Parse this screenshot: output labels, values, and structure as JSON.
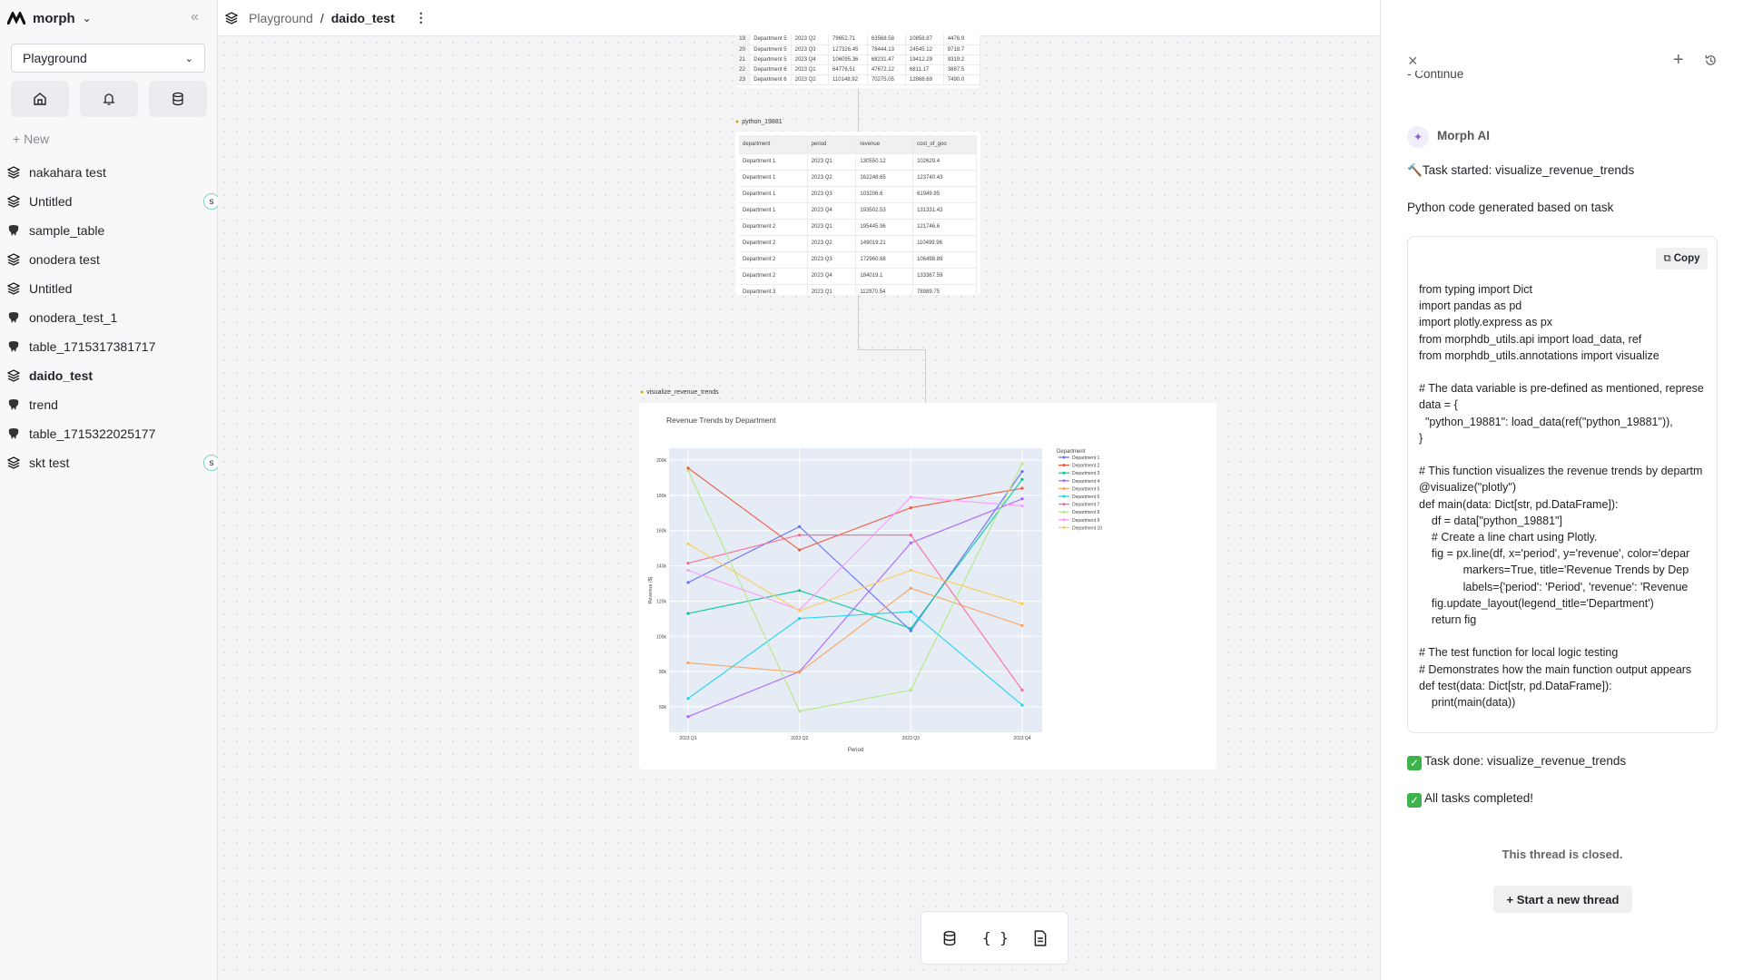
{
  "app": {
    "name": "morph"
  },
  "sidebar": {
    "workspace": "Playground",
    "new_label": "New",
    "items": [
      {
        "label": "nakahara test",
        "icon": "canvas-icon",
        "badge": ""
      },
      {
        "label": "Untitled",
        "icon": "canvas-icon",
        "badge": "s"
      },
      {
        "label": "sample_table",
        "icon": "postgres-icon",
        "badge": ""
      },
      {
        "label": "onodera test",
        "icon": "canvas-icon",
        "badge": ""
      },
      {
        "label": "Untitled",
        "icon": "canvas-icon",
        "badge": ""
      },
      {
        "label": "onodera_test_1",
        "icon": "postgres-icon",
        "badge": ""
      },
      {
        "label": "table_1715317381717",
        "icon": "postgres-icon",
        "badge": ""
      },
      {
        "label": "daido_test",
        "icon": "canvas-icon",
        "badge": "",
        "active": true
      },
      {
        "label": "trend",
        "icon": "postgres-icon",
        "badge": ""
      },
      {
        "label": "table_1715322025177",
        "icon": "postgres-icon",
        "badge": ""
      },
      {
        "label": "skt test",
        "icon": "canvas-icon",
        "badge": "s"
      }
    ]
  },
  "breadcrumb": {
    "parent": "Playground",
    "current": "daido_test",
    "sep": "/"
  },
  "top_table": {
    "rows": [
      [
        "19",
        "Department 5",
        "2023 Q2",
        "79652.71",
        "63568.58",
        "10858.87",
        "4476.9"
      ],
      [
        "20",
        "Department 5",
        "2023 Q3",
        "127326.45",
        "78444.13",
        "24545.12",
        "9718.7"
      ],
      [
        "21",
        "Department 5",
        "2023 Q4",
        "106095.36",
        "68231.47",
        "19412.29",
        "9319.2"
      ],
      [
        "22",
        "Department 6",
        "2023 Q1",
        "64776.51",
        "47672.12",
        "6811.17",
        "3887.5"
      ],
      [
        "23",
        "Department 6",
        "2023 Q2",
        "110148.92",
        "70275.05",
        "12868.69",
        "7490.0"
      ]
    ]
  },
  "python_node": {
    "label": "python_19881",
    "columns": [
      "department",
      "period",
      "revenue",
      "cost_of_goo"
    ],
    "rows": [
      [
        "Department 1",
        "2023 Q1",
        "130550.12",
        "102629.4"
      ],
      [
        "Department 1",
        "2023 Q2",
        "162248.65",
        "123740.43"
      ],
      [
        "Department 1",
        "2023 Q3",
        "103206.6",
        "61949.95"
      ],
      [
        "Department 1",
        "2023 Q4",
        "193502.53",
        "131331.43"
      ],
      [
        "Department 2",
        "2023 Q1",
        "195445.96",
        "121746.6"
      ],
      [
        "Department 2",
        "2023 Q2",
        "149019.21",
        "110499.96"
      ],
      [
        "Department 2",
        "2023 Q3",
        "172960.68",
        "106498.89"
      ],
      [
        "Department 2",
        "2023 Q4",
        "184019.1",
        "133367.59"
      ],
      [
        "Department 3",
        "2023 Q1",
        "112970.54",
        "78989.75"
      ]
    ]
  },
  "viz_node": {
    "label": "visualize_revenue_trends"
  },
  "chart_data": {
    "type": "line",
    "title": "Revenue Trends by Department",
    "xlabel": "Period",
    "ylabel": "Revenue ($)",
    "categories": [
      "2023 Q1",
      "2023 Q2",
      "2023 Q3",
      "2023 Q4"
    ],
    "ylim": [
      45600,
      206700
    ],
    "yticks": [
      60000,
      80000,
      100000,
      120000,
      140000,
      160000,
      180000,
      200000
    ],
    "ytick_labels": [
      "60k",
      "80k",
      "100k",
      "120k",
      "140k",
      "160k",
      "180k",
      "200k"
    ],
    "grid": true,
    "legend_title": "Department",
    "legend_position": "right",
    "series": [
      {
        "name": "Department 1",
        "color": "#636efa",
        "values": [
          130550,
          162249,
          103207,
          193503
        ]
      },
      {
        "name": "Department 2",
        "color": "#EF553B",
        "values": [
          195446,
          149019,
          172961,
          184019
        ]
      },
      {
        "name": "Department 3",
        "color": "#00cc96",
        "values": [
          112971,
          126000,
          104500,
          189000
        ]
      },
      {
        "name": "Department 4",
        "color": "#ab63fa",
        "values": [
          54500,
          80000,
          153000,
          178000
        ]
      },
      {
        "name": "Department 5",
        "color": "#FFA15A",
        "values": [
          85000,
          79653,
          127326,
          106095
        ]
      },
      {
        "name": "Department 6",
        "color": "#19d3f3",
        "values": [
          64777,
          110149,
          114000,
          61000
        ]
      },
      {
        "name": "Department 7",
        "color": "#FF6692",
        "values": [
          141500,
          157500,
          157500,
          69500
        ]
      },
      {
        "name": "Department 8",
        "color": "#B6E880",
        "values": [
          194000,
          57500,
          69500,
          198000
        ]
      },
      {
        "name": "Department 9",
        "color": "#FF97FF",
        "values": [
          137500,
          115000,
          179000,
          174000
        ]
      },
      {
        "name": "Department 10",
        "color": "#FECB52",
        "values": [
          152500,
          114500,
          137500,
          118500
        ]
      }
    ]
  },
  "panel": {
    "continue_text": "- Continue",
    "sender": "Morph AI",
    "task_started": "Task started: visualize_revenue_trends",
    "code_intro": "Python code generated based on task",
    "copy_label": "Copy",
    "code": "from typing import Dict\nimport pandas as pd\nimport plotly.express as px\nfrom morphdb_utils.api import load_data, ref\nfrom morphdb_utils.annotations import visualize\n\n# The data variable is pre-defined as mentioned, represe\ndata = {\n  \"python_19881\": load_data(ref(\"python_19881\")),\n}\n\n# This function visualizes the revenue trends by departm\n@visualize(\"plotly\")\ndef main(data: Dict[str, pd.DataFrame]):\n    df = data[\"python_19881\"]\n    # Create a line chart using Plotly.\n    fig = px.line(df, x='period', y='revenue', color='depar\n              markers=True, title='Revenue Trends by Dep\n              labels={'period': 'Period', 'revenue': 'Revenue\n    fig.update_layout(legend_title='Department')\n    return fig\n\n# The test function for local logic testing\n# Demonstrates how the main function output appears\ndef test(data: Dict[str, pd.DataFrame]):\n    print(main(data))",
    "task_done": "Task done: visualize_revenue_trends",
    "all_done": "All tasks completed!",
    "closed": "This thread is closed.",
    "new_thread": "+ Start a new thread"
  }
}
